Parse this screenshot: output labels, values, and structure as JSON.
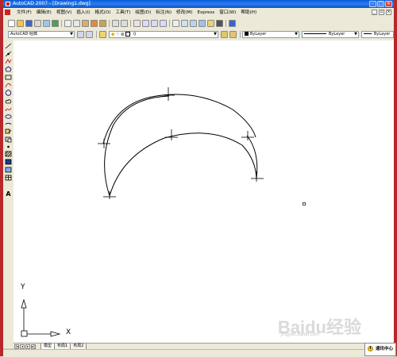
{
  "window": {
    "title": "AutoCAD 2007 - [Drawing1.dwg]"
  },
  "menu": {
    "items": [
      "文件(F)",
      "编辑(E)",
      "视图(V)",
      "插入(I)",
      "格式(O)",
      "工具(T)",
      "绘图(D)",
      "标注(N)",
      "修改(M)",
      "Express",
      "窗口(W)",
      "帮助(H)"
    ]
  },
  "toolbar2": {
    "workspace": "AutoCAD 经典",
    "layer": "0",
    "color": "ByLayer",
    "linetype": "ByLayer",
    "lineweight": "ByLayer"
  },
  "ucs": {
    "x_label": "X",
    "y_label": "Y"
  },
  "tabs": [
    "模型",
    "布局1",
    "布局2"
  ],
  "notify": {
    "label": "通讯中心"
  },
  "watermark": {
    "text": "Baidu经验",
    "sub": "jingyan.baidu.com"
  },
  "colors": {
    "title_blue": "#0a5bd8",
    "frame_red": "#b8272b",
    "canvas": "#ffffff"
  },
  "icons": [
    "new-icon",
    "open-icon",
    "save-icon",
    "print-icon",
    "preview-icon",
    "publish-icon",
    "cut-icon",
    "copy-icon",
    "paste-icon",
    "matchprop-icon",
    "undo-icon",
    "redo-icon",
    "pan-icon",
    "zoom-realtime-icon",
    "zoom-window-icon",
    "zoom-previous-icon",
    "properties-icon",
    "designcenter-icon",
    "toolpalettes-icon",
    "sheetset-icon",
    "markup-icon",
    "calculator-icon",
    "help-icon"
  ]
}
